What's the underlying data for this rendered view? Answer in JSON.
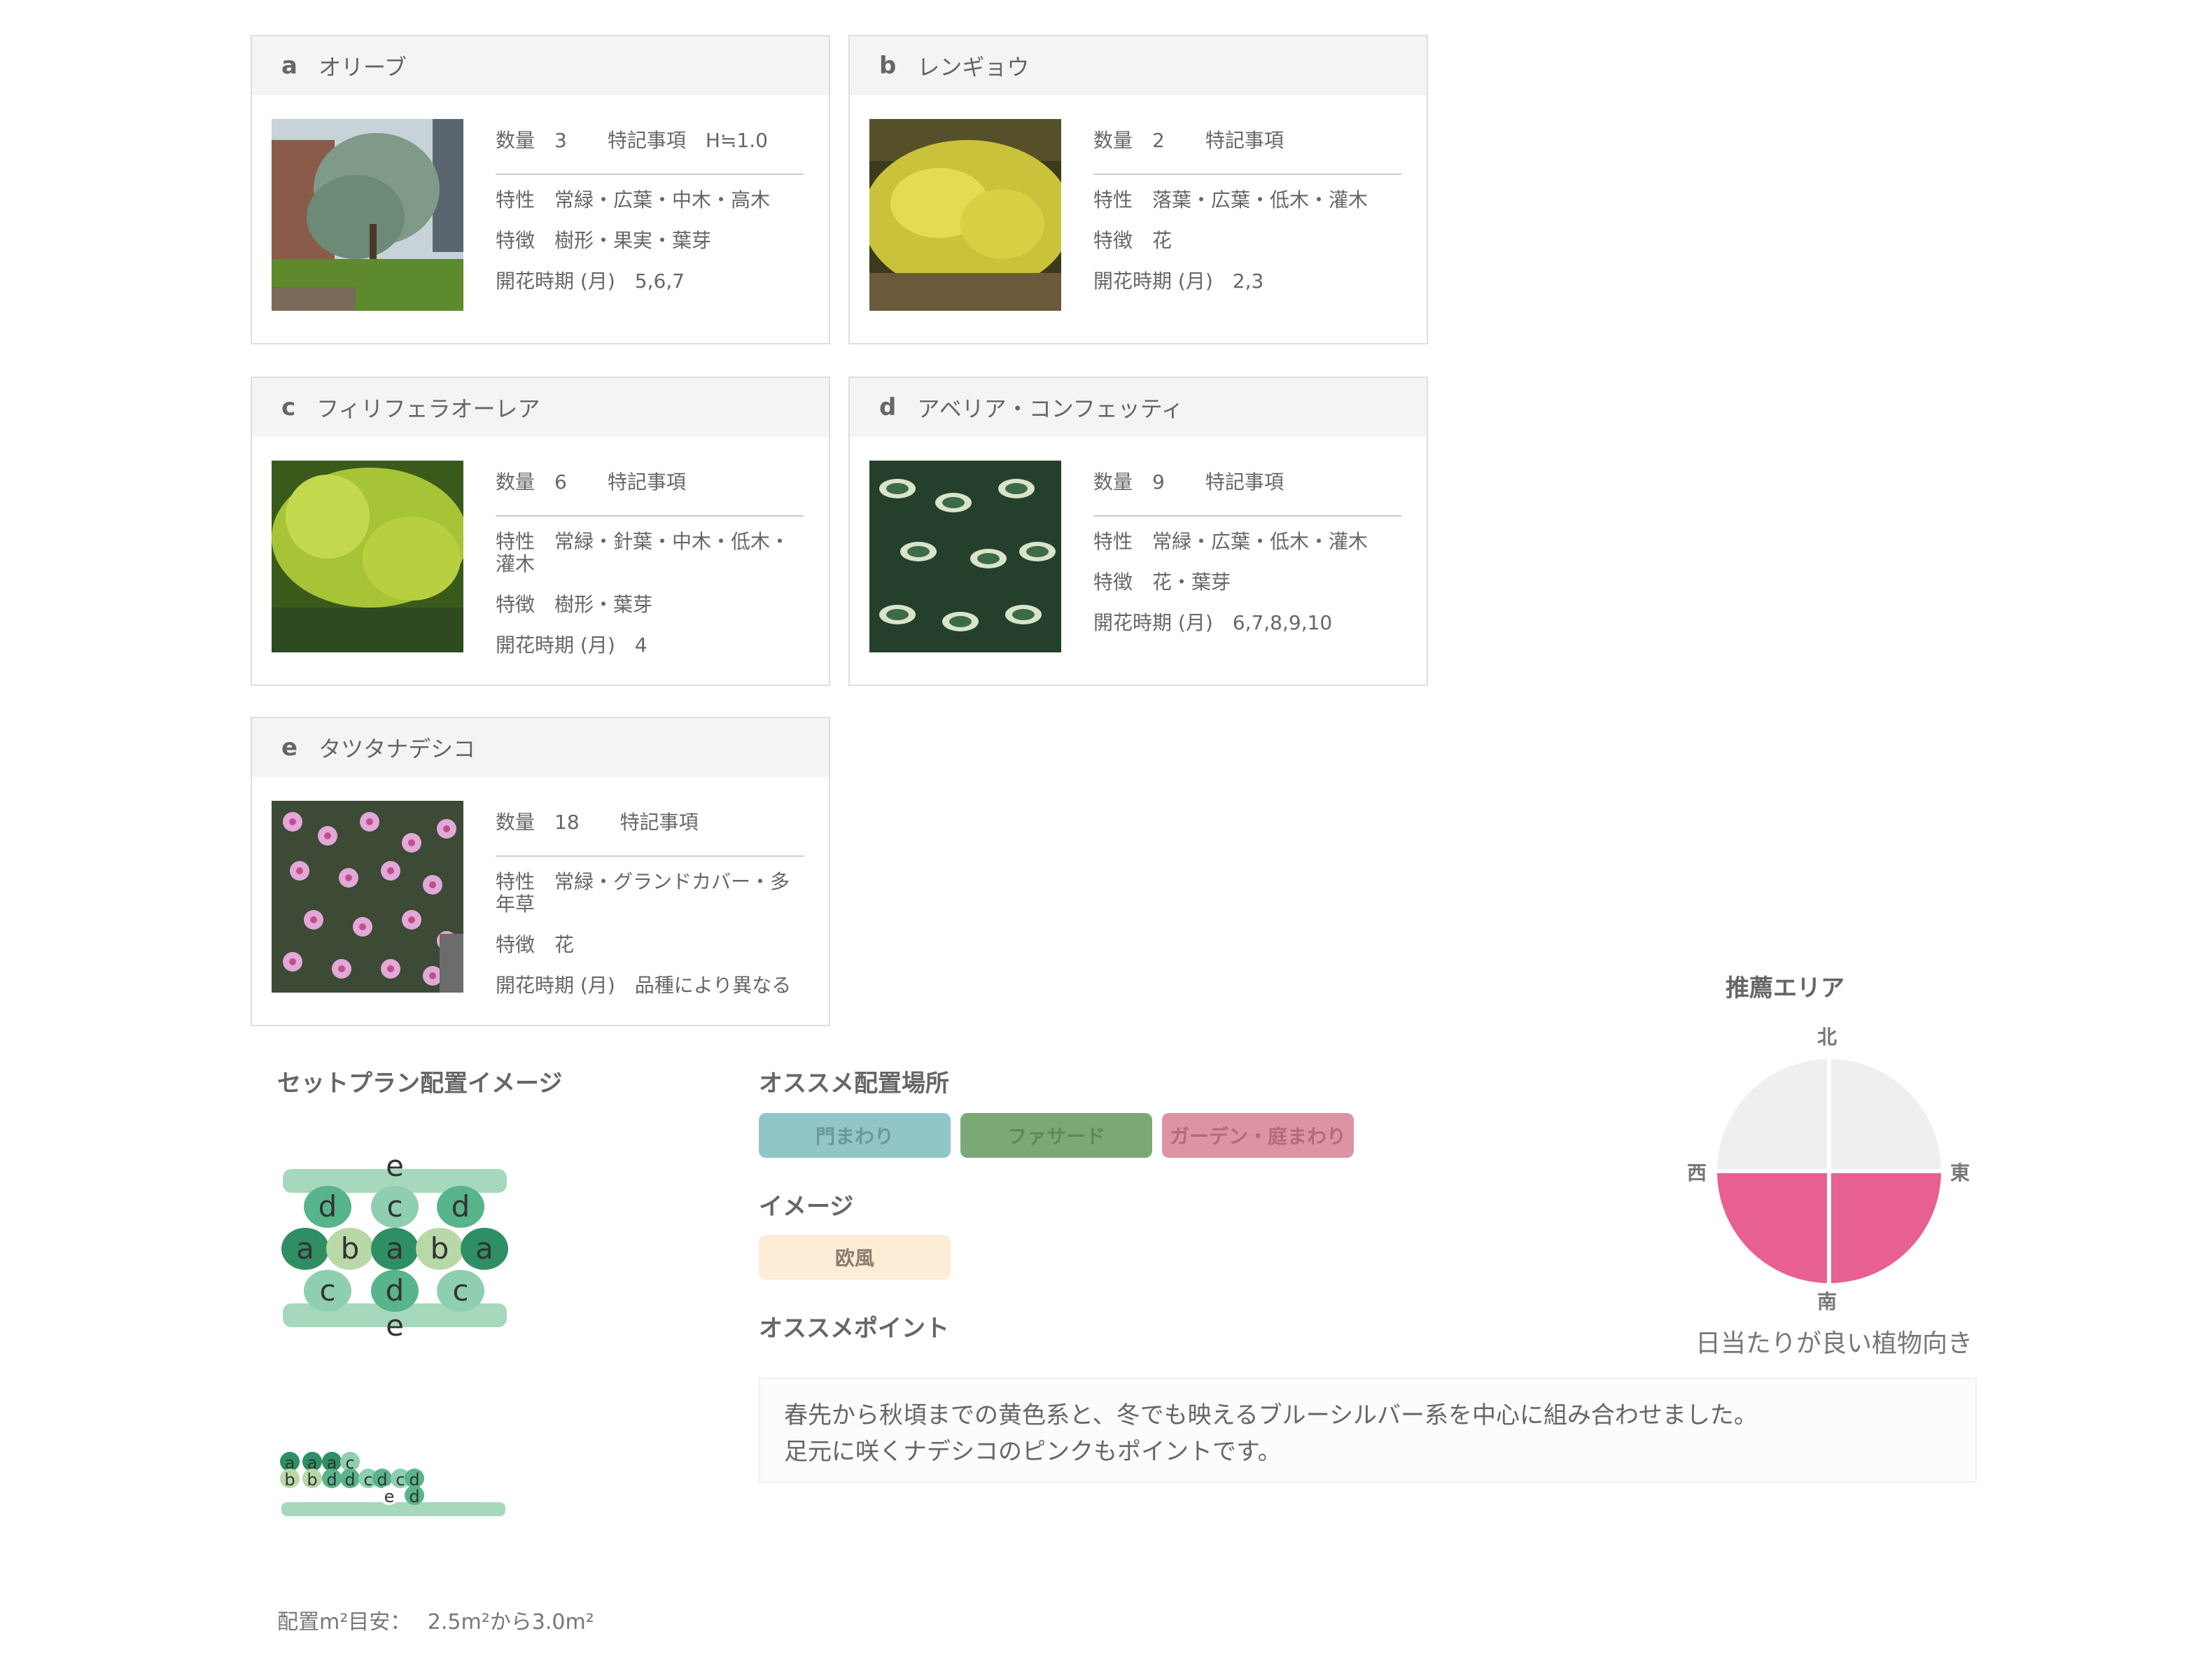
{
  "plants": [
    {
      "letter": "a",
      "name": "オリーブ",
      "qty_label": "数量",
      "qty": "3",
      "note_label": "特記事項",
      "note": "H≒1.0",
      "trait_label": "特性",
      "trait": "常緑・広葉・中木・高木",
      "feature_label": "特徴",
      "feature": "樹形・果実・葉芽",
      "bloom_label": "開花時期 (月)",
      "bloom": "5,6,7"
    },
    {
      "letter": "b",
      "name": "レンギョウ",
      "qty_label": "数量",
      "qty": "2",
      "note_label": "特記事項",
      "note": "",
      "trait_label": "特性",
      "trait": "落葉・広葉・低木・灌木",
      "feature_label": "特徴",
      "feature": "花",
      "bloom_label": "開花時期 (月)",
      "bloom": "2,3"
    },
    {
      "letter": "c",
      "name": "フィリフェラオーレア",
      "qty_label": "数量",
      "qty": "6",
      "note_label": "特記事項",
      "note": "",
      "trait_label": "特性",
      "trait": "常緑・針葉・中木・低木・灌木",
      "feature_label": "特徴",
      "feature": "樹形・葉芽",
      "bloom_label": "開花時期 (月)",
      "bloom": "4"
    },
    {
      "letter": "d",
      "name": "アベリア・コンフェッティ",
      "qty_label": "数量",
      "qty": "9",
      "note_label": "特記事項",
      "note": "",
      "trait_label": "特性",
      "trait": "常緑・広葉・低木・灌木",
      "feature_label": "特徴",
      "feature": "花・葉芽",
      "bloom_label": "開花時期 (月)",
      "bloom": "6,7,8,9,10"
    },
    {
      "letter": "e",
      "name": "タツタナデシコ",
      "qty_label": "数量",
      "qty": "18",
      "note_label": "特記事項",
      "note": "",
      "trait_label": "特性",
      "trait": "常緑・グランドカバー・多年草",
      "feature_label": "特徴",
      "feature": "花",
      "bloom_label": "開花時期 (月)",
      "bloom": "品種により異なる"
    }
  ],
  "layout_image": {
    "title": "セットプラン配置イメージ",
    "front_rows": [
      [
        "e"
      ],
      [
        "d",
        "c",
        "d"
      ],
      [
        "a",
        "b",
        "a",
        "b",
        "a"
      ],
      [
        "c",
        "d",
        "c"
      ],
      [
        "e"
      ]
    ],
    "side_sequence": [
      "a",
      "b",
      "a",
      "b",
      "a",
      "d",
      "c",
      "d",
      "c",
      "d",
      "c",
      "d",
      "e",
      "d"
    ],
    "area_label": "配置m²目安：",
    "area_value": "2.5m²から3.0m²"
  },
  "placement": {
    "title": "オススメ配置場所",
    "tags": [
      {
        "label": "門まわり",
        "bg": "#92c6c6",
        "fg": "#6d9898"
      },
      {
        "label": "ファサード",
        "bg": "#7ca878",
        "fg": "#5e8a5a"
      },
      {
        "label": "ガーデン・庭まわり",
        "bg": "#dd93a2",
        "fg": "#b06c7b"
      }
    ]
  },
  "image": {
    "title": "イメージ",
    "tags": [
      {
        "label": "欧風",
        "bg": "#fdedd6",
        "fg": "#8a7d6c"
      }
    ]
  },
  "point": {
    "title": "オススメポイント",
    "lines": [
      "春先から秋頃までの黄色系と、冬でも映えるブルーシルバー系を中心に組み合わせました。",
      "足元に咲くナデシコのピンクもポイントです。"
    ]
  },
  "recommend": {
    "title": "推薦エリア",
    "north": "北",
    "south": "南",
    "east": "東",
    "west": "西",
    "caption": "日当たりが良い植物向き",
    "quadrants": {
      "ne": false,
      "nw": false,
      "se": true,
      "sw": true
    },
    "active_color": "#e85f92",
    "inactive_color": "#efefef"
  }
}
